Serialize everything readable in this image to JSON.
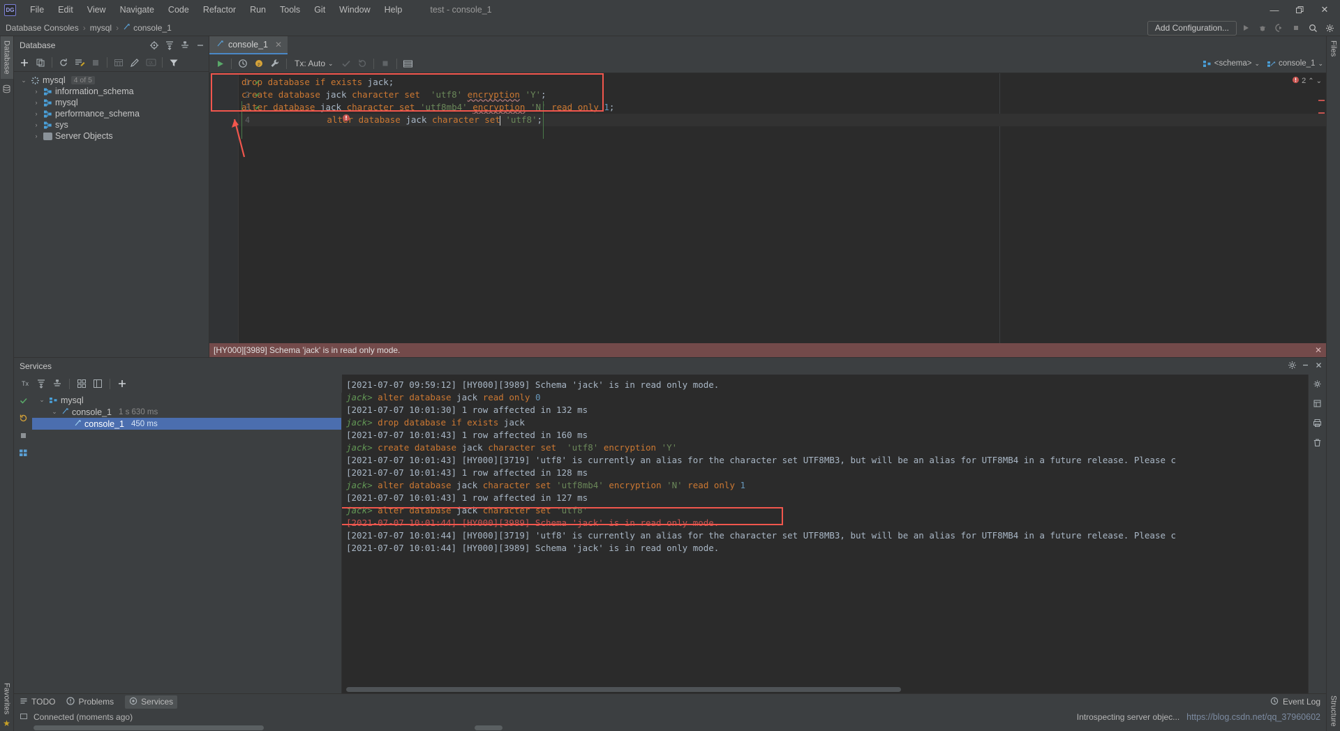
{
  "window": {
    "title": "test - console_1",
    "logo_text": "DG",
    "controls": {
      "minimize": "—",
      "maximize": "❐",
      "close": "✕"
    }
  },
  "menu": {
    "items": [
      "File",
      "Edit",
      "View",
      "Navigate",
      "Code",
      "Refactor",
      "Run",
      "Tools",
      "Git",
      "Window",
      "Help"
    ]
  },
  "navbar": {
    "breadcrumbs": [
      "Database Consoles",
      "mysql",
      "console_1"
    ],
    "separator": "›",
    "add_configuration": "Add Configuration...",
    "icons": [
      "run-icon",
      "debug-icon",
      "run-with-coverage-icon",
      "stop-icon",
      "search-everywhere-icon",
      "settings-icon"
    ]
  },
  "left_strip": {
    "database_tab": "Database",
    "favorites_tab": "Favorites"
  },
  "right_strip": {
    "files_tab": "Files",
    "structure_tab": "Structure"
  },
  "database_panel": {
    "title": "Database",
    "toolbar": [
      "add-icon",
      "copy-icon",
      "refresh-icon",
      "sql-script-icon",
      "stop-icon",
      "table-icon",
      "edit-icon",
      "ql-icon",
      "filter-icon"
    ],
    "header_actions": [
      "locate-icon",
      "expand-all-icon",
      "collapse-all-icon",
      "hide-icon"
    ],
    "tree": [
      {
        "label": "mysql",
        "badge": "4 of 5",
        "icon": "datasource-icon",
        "depth": 0,
        "expanded": true
      },
      {
        "label": "information_schema",
        "badge": "",
        "icon": "schema-icon",
        "depth": 1,
        "expanded": false
      },
      {
        "label": "mysql",
        "badge": "",
        "icon": "schema-icon",
        "depth": 1,
        "expanded": false
      },
      {
        "label": "performance_schema",
        "badge": "",
        "icon": "schema-icon",
        "depth": 1,
        "expanded": false
      },
      {
        "label": "sys",
        "badge": "",
        "icon": "schema-icon",
        "depth": 1,
        "expanded": false
      },
      {
        "label": "Server Objects",
        "badge": "",
        "icon": "folder-icon",
        "depth": 1,
        "expanded": false
      }
    ]
  },
  "editor": {
    "tab_label": "console_1",
    "tab_close": "✕",
    "toolbar": {
      "execute": "run-icon",
      "history": "history-icon",
      "p_icon": "parameters-icon",
      "wrench": "datasource-properties-icon",
      "tx_label": "Tx: Auto",
      "commit": "commit-icon",
      "rollback": "rollback-icon",
      "stop": "stop-icon",
      "table_editor": "table-editor-icon"
    },
    "schema_selector": "<schema>",
    "session_selector": "console_1",
    "inspection_count": "2",
    "lines": [
      {
        "number": "1",
        "status": "ok",
        "tokens": [
          {
            "t": "drop",
            "c": "kw"
          },
          {
            "t": " ",
            "c": "plain"
          },
          {
            "t": "database",
            "c": "kw"
          },
          {
            "t": " ",
            "c": "plain"
          },
          {
            "t": "if",
            "c": "kw"
          },
          {
            "t": " ",
            "c": "plain"
          },
          {
            "t": "exists",
            "c": "kw"
          },
          {
            "t": " ",
            "c": "plain"
          },
          {
            "t": "jack",
            "c": "id"
          },
          {
            "t": ";",
            "c": "plain"
          }
        ]
      },
      {
        "number": "2",
        "status": "ok",
        "tokens": [
          {
            "t": "create",
            "c": "kw"
          },
          {
            "t": " ",
            "c": "plain"
          },
          {
            "t": "database",
            "c": "kw"
          },
          {
            "t": " ",
            "c": "plain"
          },
          {
            "t": "jack",
            "c": "id"
          },
          {
            "t": " ",
            "c": "plain"
          },
          {
            "t": "character",
            "c": "kw"
          },
          {
            "t": " ",
            "c": "plain"
          },
          {
            "t": "set",
            "c": "kw"
          },
          {
            "t": "  ",
            "c": "plain"
          },
          {
            "t": "'utf8'",
            "c": "str"
          },
          {
            "t": " ",
            "c": "plain"
          },
          {
            "t": "encryption",
            "c": "kw wavy"
          },
          {
            "t": " ",
            "c": "plain"
          },
          {
            "t": "'Y'",
            "c": "str"
          },
          {
            "t": ";",
            "c": "plain"
          }
        ]
      },
      {
        "number": "3",
        "status": "ok",
        "tokens": [
          {
            "t": "alter",
            "c": "kw"
          },
          {
            "t": " ",
            "c": "plain"
          },
          {
            "t": "database",
            "c": "kw"
          },
          {
            "t": " ",
            "c": "plain"
          },
          {
            "t": "jack",
            "c": "id"
          },
          {
            "t": " ",
            "c": "plain"
          },
          {
            "t": "character",
            "c": "kw"
          },
          {
            "t": " ",
            "c": "plain"
          },
          {
            "t": "set",
            "c": "kw"
          },
          {
            "t": " ",
            "c": "plain"
          },
          {
            "t": "'utf8mb4'",
            "c": "str"
          },
          {
            "t": " ",
            "c": "plain"
          },
          {
            "t": "encryption",
            "c": "kw wavy"
          },
          {
            "t": " ",
            "c": "plain"
          },
          {
            "t": "'N'",
            "c": "str"
          },
          {
            "t": " ",
            "c": "plain"
          },
          {
            "t": "read",
            "c": "kw"
          },
          {
            "t": " ",
            "c": "plain"
          },
          {
            "t": "only",
            "c": "kw"
          },
          {
            "t": " ",
            "c": "plain"
          },
          {
            "t": "1",
            "c": "num"
          },
          {
            "t": ";",
            "c": "plain"
          }
        ]
      },
      {
        "number": "4",
        "status": "error",
        "current": true,
        "tokens": [
          {
            "t": "alter",
            "c": "kw"
          },
          {
            "t": " ",
            "c": "plain"
          },
          {
            "t": "database",
            "c": "kw"
          },
          {
            "t": " ",
            "c": "plain"
          },
          {
            "t": "jack",
            "c": "id"
          },
          {
            "t": " ",
            "c": "plain"
          },
          {
            "t": "character",
            "c": "kw"
          },
          {
            "t": " ",
            "c": "plain"
          },
          {
            "t": "set",
            "c": "kw"
          },
          {
            "t": "|",
            "c": "caret"
          },
          {
            "t": " ",
            "c": "plain"
          },
          {
            "t": "'utf8'",
            "c": "str"
          },
          {
            "t": ";",
            "c": "plain"
          }
        ]
      }
    ]
  },
  "error_banner": {
    "message": "[HY000][3989] Schema 'jack' is in read only mode.",
    "close": "✕"
  },
  "services_panel": {
    "title": "Services",
    "header_actions": [
      "settings-icon",
      "minimize-icon",
      "close-icon"
    ],
    "toolbar": [
      "tx-icon",
      "expand-all-icon",
      "collapse-all-icon",
      "group-icon",
      "layout-icon",
      "add-icon"
    ],
    "rail_icons": [
      "run-icon",
      "rerun-icon",
      "stop-icon",
      "grid-icon"
    ],
    "right_rail_icons": [
      "settings-icon",
      "export-icon",
      "print-icon",
      "delete-icon"
    ],
    "tree": [
      {
        "label": "mysql",
        "meta": "",
        "icon": "datasource-icon",
        "depth": 0,
        "expanded": true,
        "selected": false
      },
      {
        "label": "console_1",
        "meta": "1 s 630 ms",
        "icon": "console-icon",
        "depth": 1,
        "expanded": true,
        "selected": false
      },
      {
        "label": "console_1",
        "meta": "450 ms",
        "icon": "console-icon",
        "depth": 2,
        "expanded": false,
        "selected": true
      }
    ],
    "log": [
      {
        "type": "result",
        "text": "[2021-07-07 09:59:12] [HY000][3989] Schema 'jack' is in read only mode."
      },
      {
        "type": "query",
        "prompt": "jack>",
        "tokens": [
          {
            "t": " alter",
            "c": "kw"
          },
          {
            "t": " database",
            "c": "kw"
          },
          {
            "t": " jack",
            "c": "plain"
          },
          {
            "t": " read",
            "c": "kw"
          },
          {
            "t": " only",
            "c": "kw"
          },
          {
            "t": " 0",
            "c": "num"
          }
        ]
      },
      {
        "type": "result",
        "text": "[2021-07-07 10:01:30] 1 row affected in 132 ms"
      },
      {
        "type": "query",
        "prompt": "jack>",
        "tokens": [
          {
            "t": " drop",
            "c": "kw"
          },
          {
            "t": " database",
            "c": "kw"
          },
          {
            "t": " if",
            "c": "kw"
          },
          {
            "t": " exists",
            "c": "kw"
          },
          {
            "t": " jack",
            "c": "plain"
          }
        ]
      },
      {
        "type": "result",
        "text": "[2021-07-07 10:01:43] 1 row affected in 160 ms"
      },
      {
        "type": "query",
        "prompt": "jack>",
        "tokens": [
          {
            "t": " create",
            "c": "kw"
          },
          {
            "t": " database",
            "c": "kw"
          },
          {
            "t": " jack",
            "c": "plain"
          },
          {
            "t": " character",
            "c": "kw"
          },
          {
            "t": " set",
            "c": "kw"
          },
          {
            "t": "  'utf8'",
            "c": "str"
          },
          {
            "t": " encryption",
            "c": "kw"
          },
          {
            "t": " 'Y'",
            "c": "str"
          }
        ]
      },
      {
        "type": "result",
        "text": "[2021-07-07 10:01:43] [HY000][3719] 'utf8' is currently an alias for the character set UTF8MB3, but will be an alias for UTF8MB4 in a future release. Please c"
      },
      {
        "type": "result",
        "text": "[2021-07-07 10:01:43] 1 row affected in 128 ms"
      },
      {
        "type": "query",
        "prompt": "jack>",
        "tokens": [
          {
            "t": " alter",
            "c": "kw"
          },
          {
            "t": " database",
            "c": "kw"
          },
          {
            "t": " jack",
            "c": "plain"
          },
          {
            "t": " character",
            "c": "kw"
          },
          {
            "t": " set",
            "c": "kw"
          },
          {
            "t": " 'utf8mb4'",
            "c": "str"
          },
          {
            "t": " encryption",
            "c": "kw"
          },
          {
            "t": " 'N'",
            "c": "str"
          },
          {
            "t": " read",
            "c": "kw"
          },
          {
            "t": " only",
            "c": "kw"
          },
          {
            "t": " 1",
            "c": "num"
          }
        ]
      },
      {
        "type": "result",
        "text": "[2021-07-07 10:01:43] 1 row affected in 127 ms"
      },
      {
        "type": "query",
        "prompt": "jack>",
        "tokens": [
          {
            "t": " alter",
            "c": "kw"
          },
          {
            "t": " database",
            "c": "kw"
          },
          {
            "t": " jack",
            "c": "plain"
          },
          {
            "t": " character",
            "c": "kw"
          },
          {
            "t": " set",
            "c": "kw"
          },
          {
            "t": " 'utf8'",
            "c": "str"
          }
        ]
      },
      {
        "type": "error",
        "text": "[2021-07-07 10:01:44] [HY000][3989] Schema 'jack' is in read only mode."
      },
      {
        "type": "result",
        "text": "[2021-07-07 10:01:44] [HY000][3719] 'utf8' is currently an alias for the character set UTF8MB3, but will be an alias for UTF8MB4 in a future release. Please c"
      },
      {
        "type": "result",
        "text": "[2021-07-07 10:01:44] [HY000][3989] Schema 'jack' is in read only mode."
      }
    ]
  },
  "bottom_toolbar": {
    "items": [
      {
        "label": "TODO",
        "icon": "todo-icon",
        "active": false
      },
      {
        "label": "Problems",
        "icon": "problems-icon",
        "active": false
      },
      {
        "label": "Services",
        "icon": "services-icon",
        "active": true
      }
    ],
    "event_log": "Event Log"
  },
  "status_bar": {
    "left": "Connected (moments ago)",
    "right_text": "Introspecting server objec...",
    "watermark": "https://blog.csdn.net/qq_37960602"
  },
  "colors": {
    "accent": "#4a88c7",
    "annotation": "#f1564d",
    "error_bg": "#734a4a",
    "ok_green": "#4c9f4c",
    "error_red": "#d9534f",
    "keyword": "#cc7832",
    "string": "#6a8759",
    "selection": "#4b6eaf"
  }
}
